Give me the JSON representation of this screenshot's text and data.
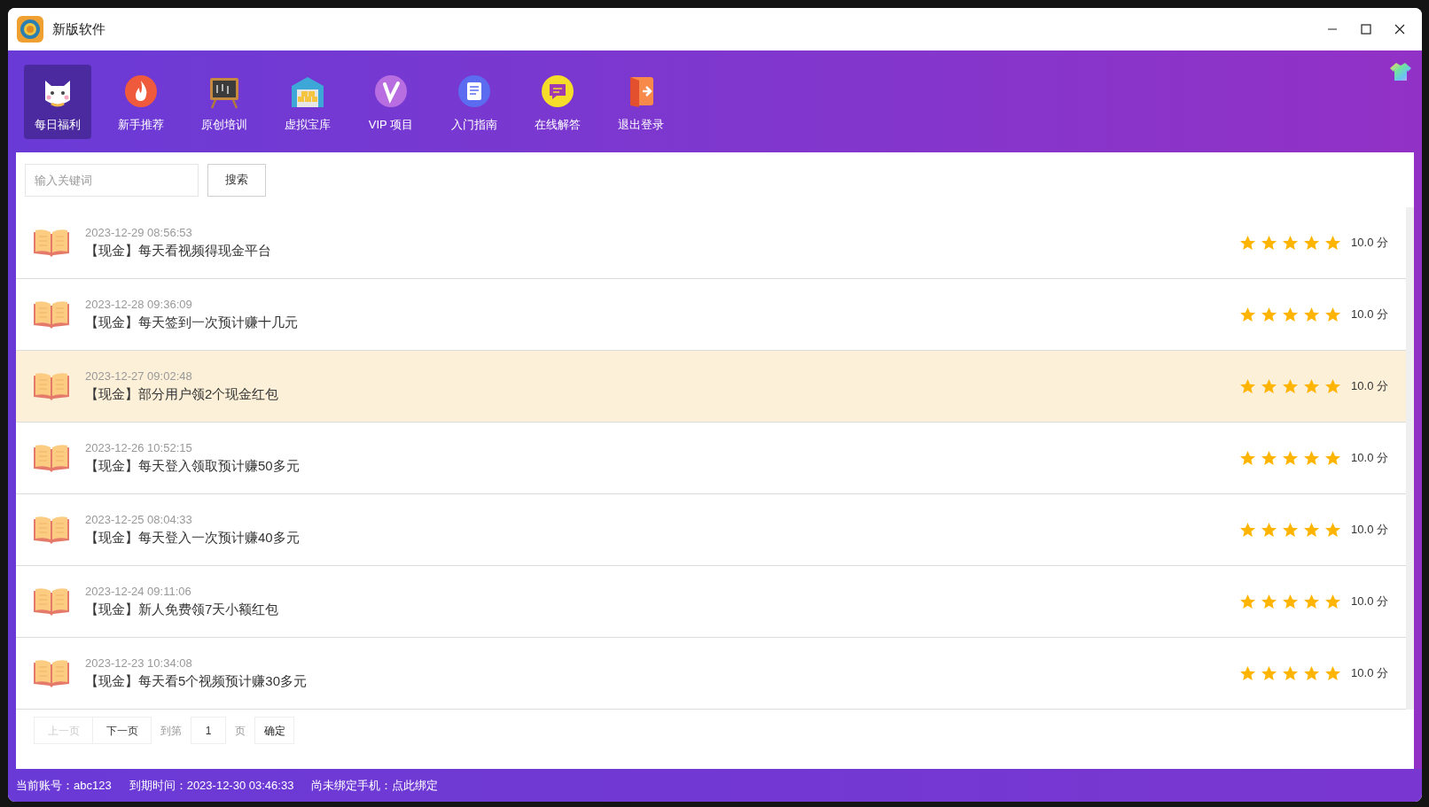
{
  "window": {
    "title": "新版软件"
  },
  "nav": [
    {
      "label": "每日福利",
      "selected": true
    },
    {
      "label": "新手推荐",
      "selected": false
    },
    {
      "label": "原创培训",
      "selected": false
    },
    {
      "label": "虚拟宝库",
      "selected": false
    },
    {
      "label": "VIP 项目",
      "selected": false
    },
    {
      "label": "入门指南",
      "selected": false
    },
    {
      "label": "在线解答",
      "selected": false
    },
    {
      "label": "退出登录",
      "selected": false
    }
  ],
  "search": {
    "placeholder": "输入关键词",
    "button": "搜索"
  },
  "items": [
    {
      "date": "2023-12-29 08:56:53",
      "title": "【现金】每天看视频得现金平台",
      "stars": 5,
      "score": "10.0 分",
      "highlighted": false
    },
    {
      "date": "2023-12-28 09:36:09",
      "title": "【现金】每天签到一次预计赚十几元",
      "stars": 5,
      "score": "10.0 分",
      "highlighted": false
    },
    {
      "date": "2023-12-27 09:02:48",
      "title": "【现金】部分用户领2个现金红包",
      "stars": 5,
      "score": "10.0 分",
      "highlighted": true
    },
    {
      "date": "2023-12-26 10:52:15",
      "title": "【现金】每天登入领取预计赚50多元",
      "stars": 5,
      "score": "10.0 分",
      "highlighted": false
    },
    {
      "date": "2023-12-25 08:04:33",
      "title": "【现金】每天登入一次预计赚40多元",
      "stars": 5,
      "score": "10.0 分",
      "highlighted": false
    },
    {
      "date": "2023-12-24 09:11:06",
      "title": "【现金】新人免费领7天小额红包",
      "stars": 5,
      "score": "10.0 分",
      "highlighted": false
    },
    {
      "date": "2023-12-23 10:34:08",
      "title": "【现金】每天看5个视频预计赚30多元",
      "stars": 5,
      "score": "10.0 分",
      "highlighted": false
    }
  ],
  "pagination": {
    "prev": {
      "label": "上一页",
      "disabled": true
    },
    "next": {
      "label": "下一页",
      "disabled": false
    },
    "goto_label": "到第",
    "page": "1",
    "page_suffix": "页",
    "confirm": "确定"
  },
  "status_bar": [
    "当前账号：abc123",
    "到期时间：2023-12-30 03:46:33",
    "尚未绑定手机：点此绑定"
  ]
}
